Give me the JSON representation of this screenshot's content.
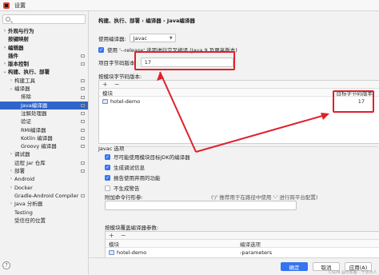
{
  "window": {
    "title": "设置"
  },
  "sidebar": {
    "items": [
      {
        "label": "外观与行为",
        "arrow": "›",
        "bold": true,
        "indent": 0
      },
      {
        "label": "按键映射",
        "arrow": "",
        "bold": true,
        "indent": 0
      },
      {
        "label": "编辑器",
        "arrow": "›",
        "bold": true,
        "indent": 0
      },
      {
        "label": "插件",
        "arrow": "",
        "bold": true,
        "indent": 0,
        "mini": true
      },
      {
        "label": "版本控制",
        "arrow": "›",
        "bold": true,
        "indent": 0,
        "mini": true
      },
      {
        "label": "构建、执行、部署",
        "arrow": "⌄",
        "bold": true,
        "indent": 0
      },
      {
        "label": "构建工具",
        "arrow": "›",
        "bold": false,
        "indent": 1,
        "mini": true
      },
      {
        "label": "编译器",
        "arrow": "⌄",
        "bold": false,
        "indent": 1,
        "mini": true
      },
      {
        "label": "排除",
        "arrow": "",
        "bold": false,
        "indent": 2,
        "mini": true
      },
      {
        "label": "Java编译器",
        "arrow": "",
        "bold": false,
        "indent": 2,
        "mini": true,
        "selected": true
      },
      {
        "label": "注解处理器",
        "arrow": "",
        "bold": false,
        "indent": 2,
        "mini": true
      },
      {
        "label": "验证",
        "arrow": "",
        "bold": false,
        "indent": 2,
        "mini": true
      },
      {
        "label": "RMI编译器",
        "arrow": "",
        "bold": false,
        "indent": 2,
        "mini": true
      },
      {
        "label": "Kotlin 编译器",
        "arrow": "",
        "bold": false,
        "indent": 2,
        "mini": true
      },
      {
        "label": "Groovy 编译器",
        "arrow": "",
        "bold": false,
        "indent": 2,
        "mini": true
      },
      {
        "label": "调试器",
        "arrow": "›",
        "bold": false,
        "indent": 1
      },
      {
        "label": "远程 Jar 仓库",
        "arrow": "",
        "bold": false,
        "indent": 1,
        "mini": true
      },
      {
        "label": "部署",
        "arrow": "›",
        "bold": false,
        "indent": 1,
        "mini": true
      },
      {
        "label": "Android",
        "arrow": "›",
        "bold": false,
        "indent": 1
      },
      {
        "label": "Docker",
        "arrow": "›",
        "bold": false,
        "indent": 1
      },
      {
        "label": "Gradle-Android Compiler",
        "arrow": "",
        "bold": false,
        "indent": 1,
        "mini": true
      },
      {
        "label": "Java 分析器",
        "arrow": "›",
        "bold": false,
        "indent": 1
      },
      {
        "label": "Testing",
        "arrow": "",
        "bold": false,
        "indent": 1
      },
      {
        "label": "受信任的位置",
        "arrow": "",
        "bold": false,
        "indent": 1
      }
    ]
  },
  "main": {
    "breadcrumb": "构建、执行、部署 › 编译器 › Java编译器",
    "compiler_label": "使用编译器:",
    "compiler_value": "Javac",
    "release_option": "使用 '--release' 选项进行交叉编译 (Java 9 及更高版本)",
    "bytecode_label": "项目字节码版本:",
    "bytecode_value": "17",
    "per_module_label": "按模块字节码版本:",
    "module_toolbar": [
      "+",
      "−"
    ],
    "module_col": "模块",
    "target_col": "目标字节码版本",
    "module_rows": [
      {
        "name": "hotel-demo",
        "target": "17"
      }
    ],
    "javac_section": "Javac 选项",
    "javac_options": [
      {
        "label": "尽可能使用模块目标JDK的编译器",
        "checked": true
      },
      {
        "label": "生成调试信息",
        "checked": true
      },
      {
        "label": "报告使用弃用的功能",
        "checked": true
      },
      {
        "label": "不生成警告",
        "checked": false
      }
    ],
    "extra_params_label": "附加命令行形参:",
    "extra_params_hint": "('/' 推荐用于在路径中使用 '-' 进行跨平台配置)",
    "override_label": "按模块覆盖编译器参数:",
    "override_toolbar": [
      "+",
      "−"
    ],
    "override_cols": [
      "模块",
      "编译选项"
    ],
    "override_rows": [
      {
        "name": "hotel-demo",
        "options": "-parameters"
      }
    ]
  },
  "footer": {
    "ok": "确定",
    "cancel": "取消",
    "apply": "应用(A)",
    "watermark": "CSDN @乐知客 · 千点大人"
  },
  "colors": {
    "accent": "#3574f0",
    "selection": "#2f65ca",
    "annotation": "#e0202a"
  }
}
